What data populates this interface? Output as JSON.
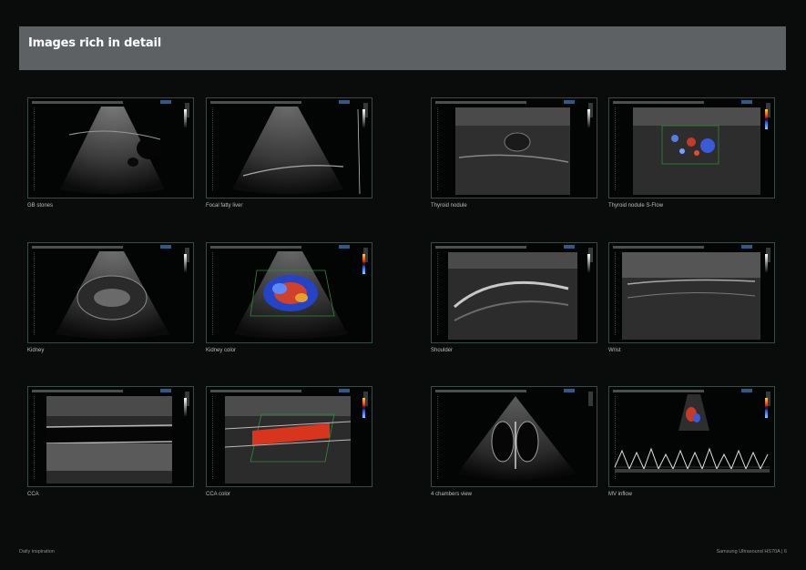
{
  "header": {
    "title": "Images rich in detail"
  },
  "panels": [
    {
      "caption": "GB stones"
    },
    {
      "caption": "Focal fatty liver"
    },
    {
      "caption": "Thyroid nodule"
    },
    {
      "caption": "Thyroid nodule S-Flow"
    },
    {
      "caption": "Kidney"
    },
    {
      "caption": "Kidney color"
    },
    {
      "caption": "Shoulder"
    },
    {
      "caption": "Wrist"
    },
    {
      "caption": "CCA"
    },
    {
      "caption": "CCA color"
    },
    {
      "caption": "4 chambers view"
    },
    {
      "caption": "MV inflow"
    }
  ],
  "footer": {
    "left": "Daily inspiration",
    "right": "Samsung Ultrasound HS70A  |  6"
  }
}
